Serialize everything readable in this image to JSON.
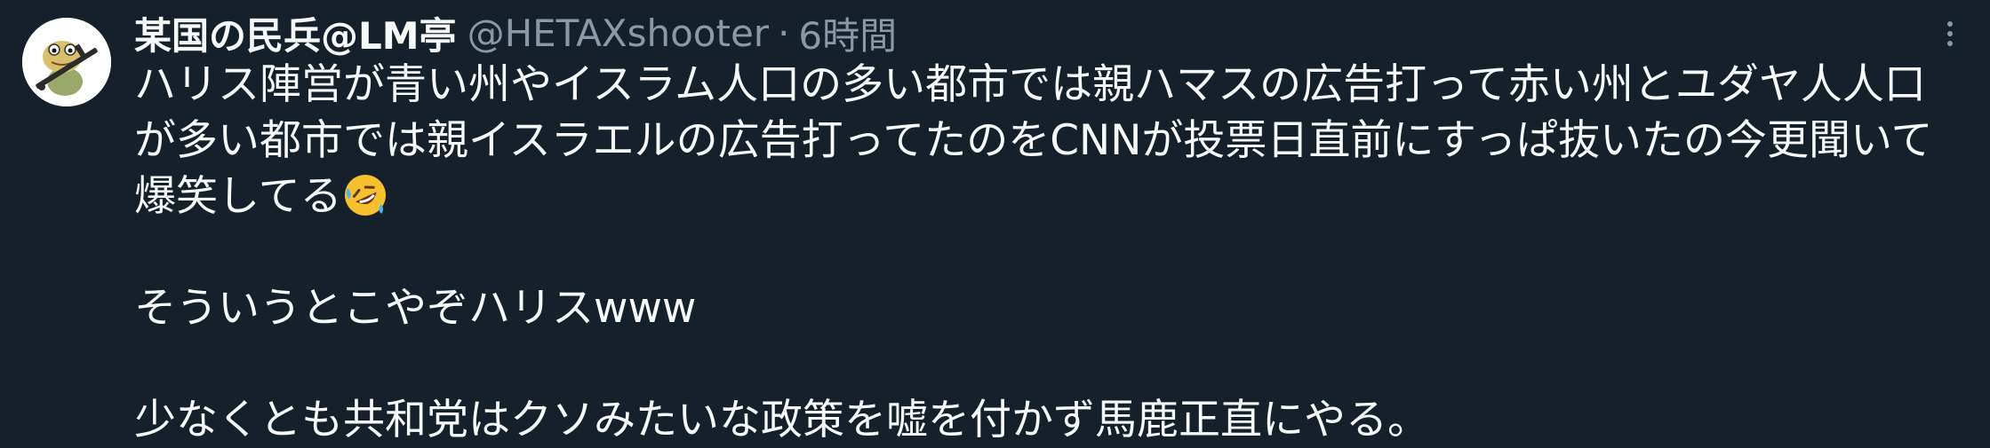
{
  "tweet": {
    "display_name": "某国の民兵@LM亭",
    "handle": "@HETAXshooter",
    "separator": "·",
    "time": "6時間",
    "avatar_icon": "frog-soldier-avatar-icon",
    "more_icon": "more-vertical-icon",
    "body": {
      "line1": "ハリス陣営が青い州やイスラム人口の多い都市では親ハマスの広告打って赤い州とユダヤ人人口",
      "line2": "が多い都市では親イスラエルの広告打ってたのをCNNが投票日直前にすっぱ抜いたの今更聞いて",
      "line3": "爆笑してる",
      "emoji": "rolling-on-floor-laughing-emoji",
      "paragraph2": "そういうとこやぞハリスwww",
      "paragraph3": "少なくとも共和党はクソみたいな政策を嘘を付かず馬鹿正直にやる。"
    }
  },
  "colors": {
    "background": "#15202b",
    "text_primary": "#f7f9f9",
    "text_secondary": "#8b98a5"
  }
}
